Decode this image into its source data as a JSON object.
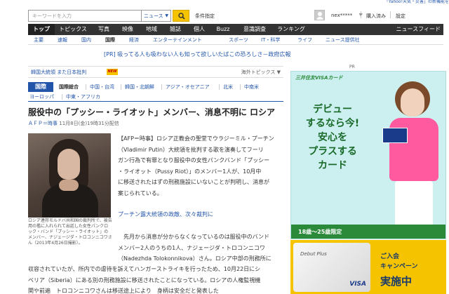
{
  "top_notice": "「Yahoo!天気・災害」の新機能を",
  "search": {
    "placeholder": "キーワードを入力",
    "scope": "ニュース",
    "advanced_label": "条件指定"
  },
  "user": {
    "name": "nex*****",
    "links": [
      "購入済み",
      "設定"
    ]
  },
  "main_nav": {
    "items": [
      "トップ",
      "トピックス",
      "写真",
      "映像",
      "地域",
      "雑誌",
      "個人",
      "Buzz",
      "意識調査",
      "ランキング"
    ],
    "active_index": 0,
    "right_label": "ニュースフィード"
  },
  "sub_nav": {
    "items": [
      "主要",
      "速報",
      "国内",
      "国際",
      "経済",
      "エンターテインメント",
      "スポーツ",
      "IT・科学",
      "ライフ",
      "ニュース提供社"
    ],
    "active_index": 3
  },
  "pr_text": "[PR] 吸ってる人も吸わない人も知って欲しいたばこの恐ろしさ－政府広報",
  "pr_label": "PR",
  "breaking": {
    "text": "韓国大統領 また日本批判",
    "badge": "NEW",
    "dropdown": "海外トピックス ▼"
  },
  "categories": {
    "tab": "国際",
    "row1": [
      "国際総合",
      "中国・台湾",
      "韓国・北朝鮮",
      "アジア・オセアニア",
      "北米",
      "中南米"
    ],
    "row2": [
      "ヨーロッパ",
      "中東・アフリカ"
    ]
  },
  "article": {
    "headline": "服役中の「プッシー・ライオット」メンバー、消息不明に ロシア",
    "source": "ＡＦＰ＝時事",
    "date": "11月8日(金)19時31分配信",
    "caption": "ロシア連邦モルドバ共和国の裁判所で、被告用の檻に入れられて出廷した女性パンクロック・バンド「プッシー・ライオット」のメンバー、ナジェージダ・トロコンニコワさん（2013年4月26日撮影）。",
    "para1_lines": [
      "【AFP＝時事】ロシア正教会の聖堂でウラジーミル・プーチン",
      "（Vladimir Putin）大統領を批判する歌を演奏してフーリ",
      "ガン行為で有罪となり服役中の女性パンクバンド「プッシー",
      "・ライオット（Pussy Riot）」のメンバー1人が、10月中",
      "に移送されたはずの刑務施設にいないことが判明し、消息が",
      "案じられている。"
    ],
    "related_link": "プーチン露大統領の政敵、次々裁判に",
    "para2_lines": [
      "先月から消息が分からなくなっているのは服役中のバンド",
      "メンバー2人のうちの1人、ナジェージダ・トロコンニコワ",
      "（Nadezhda Tolokonnikova）さん。ロシア中部の刑務所に"
    ],
    "para3_lines": [
      "収容されていたが、所内での虐待を訴えてハンガーストライキを行ったため、10月22日にシ",
      "ベリア（Siberia）にある別の刑務施設に移送されたことになっている。ロシアの人権監視機",
      "関や前遍　トロコンニコワさんは移送途上により　身柄は安全だと発表した"
    ]
  },
  "ad1": {
    "brand": "三井住友VISAカード",
    "headline_lines": [
      "デビュー",
      "するなら今!",
      "安心を",
      "プラスする",
      "カード"
    ],
    "footer": "18歳〜25歳限定"
  },
  "ad2": {
    "card_title": "Debut Plus",
    "card_brand": "VISA",
    "line1": "ご入会",
    "line2": "キャンペーン",
    "line3": "実施中"
  },
  "colors": {
    "link_blue": "#2255aa",
    "nav_dark": "#333333",
    "accent_yellow": "#f5c300",
    "ad_green": "#2a8a3a"
  }
}
